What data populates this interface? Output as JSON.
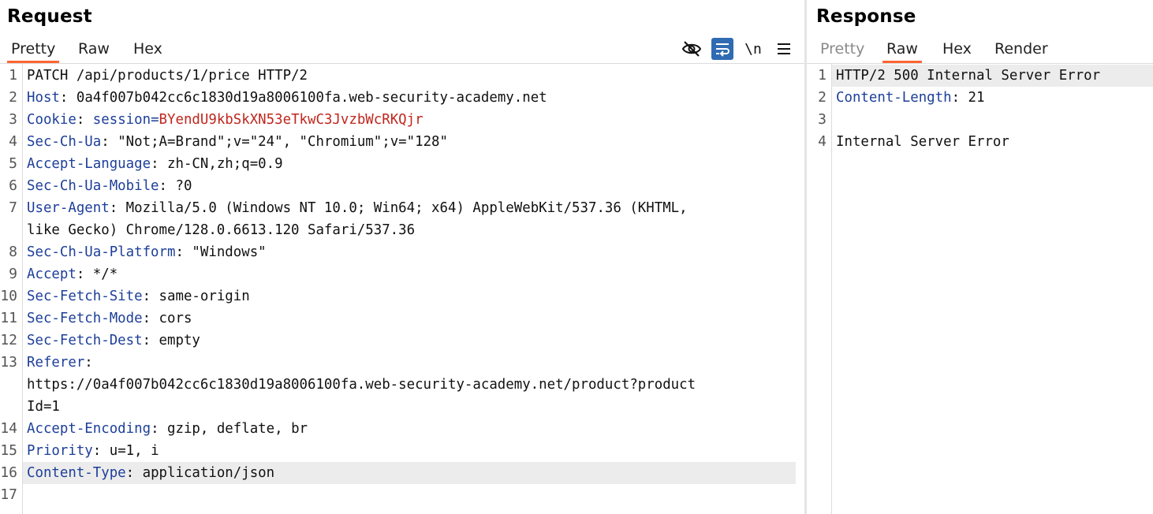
{
  "request": {
    "title": "Request",
    "tabs": [
      "Pretty",
      "Raw",
      "Hex"
    ],
    "active_tab": "Pretty",
    "toolbar": {
      "hide_icon": "eye-slash-icon",
      "wrap_icon": "word-wrap-icon",
      "newline_label": "\\n",
      "menu_icon": "hamburger-menu-icon"
    },
    "lines": [
      {
        "n": "1",
        "text": "PATCH /api/products/1/price HTTP/2"
      },
      {
        "n": "2",
        "key": "Host",
        "value": "0a4f007b042cc6c1830d19a8006100fa.web-security-academy.net"
      },
      {
        "n": "3",
        "key": "Cookie",
        "value": "session=",
        "cookie_value": "BYendU9kbSkXN53eTkwC3JvzbWcRKQjr"
      },
      {
        "n": "4",
        "key": "Sec-Ch-Ua",
        "value": "\"Not;A=Brand\";v=\"24\", \"Chromium\";v=\"128\""
      },
      {
        "n": "5",
        "key": "Accept-Language",
        "value": "zh-CN,zh;q=0.9"
      },
      {
        "n": "6",
        "key": "Sec-Ch-Ua-Mobile",
        "value": "?0"
      },
      {
        "n": "7",
        "key": "User-Agent",
        "value": "Mozilla/5.0 (Windows NT 10.0; Win64; x64) AppleWebKit/537.36 (KHTML,"
      },
      {
        "n": "",
        "text": "like Gecko) Chrome/128.0.6613.120 Safari/537.36"
      },
      {
        "n": "8",
        "key": "Sec-Ch-Ua-Platform",
        "value": "\"Windows\""
      },
      {
        "n": "9",
        "key": "Accept",
        "value": "*/*"
      },
      {
        "n": "10",
        "key": "Sec-Fetch-Site",
        "value": "same-origin"
      },
      {
        "n": "11",
        "key": "Sec-Fetch-Mode",
        "value": "cors"
      },
      {
        "n": "12",
        "key": "Sec-Fetch-Dest",
        "value": "empty"
      },
      {
        "n": "13",
        "key": "Referer",
        "value": ""
      },
      {
        "n": "",
        "text": "https://0a4f007b042cc6c1830d19a8006100fa.web-security-academy.net/product?product"
      },
      {
        "n": "",
        "text": "Id=1"
      },
      {
        "n": "14",
        "key": "Accept-Encoding",
        "value": "gzip, deflate, br"
      },
      {
        "n": "15",
        "key": "Priority",
        "value": "u=1, i"
      },
      {
        "n": "16",
        "key": "Content-Type",
        "value": "application/json",
        "highlight": true
      },
      {
        "n": "17",
        "text": ""
      }
    ]
  },
  "response": {
    "title": "Response",
    "tabs": [
      "Pretty",
      "Raw",
      "Hex",
      "Render"
    ],
    "active_tab": "Raw",
    "lines": [
      {
        "n": "1",
        "text": "HTTP/2 500 Internal Server Error",
        "highlight": true
      },
      {
        "n": "2",
        "key": "Content-Length",
        "value": "21"
      },
      {
        "n": "3",
        "text": ""
      },
      {
        "n": "4",
        "text": "Internal Server Error"
      }
    ]
  },
  "colors": {
    "active_tab_underline": "#ff6633",
    "header_key": "#1d3f99",
    "cookie_value": "#c0261d",
    "line_highlight": "#ececec",
    "wrap_button": "#2f6bb3"
  }
}
